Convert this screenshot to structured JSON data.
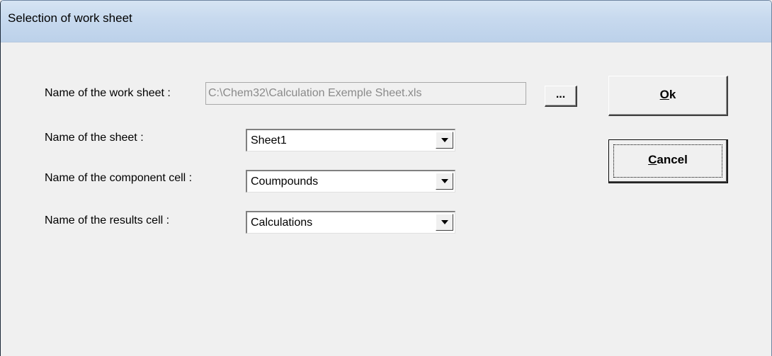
{
  "window": {
    "title": "Selection of work sheet"
  },
  "form": {
    "work_sheet_label": "Name of the work sheet :",
    "work_sheet_path": "C:\\Chem32\\Calculation Exemple Sheet.xls",
    "browse_label": "...",
    "sheet_label": "Name of the sheet :",
    "sheet_value": "Sheet1",
    "component_cell_label": "Name of the component cell :",
    "component_cell_value": "Coumpounds",
    "results_cell_label": "Name of the results cell :",
    "results_cell_value": "Calculations"
  },
  "buttons": {
    "ok_accel": "O",
    "ok_rest": "k",
    "cancel_accel": "C",
    "cancel_rest": "ancel"
  },
  "icons": {
    "combo_arrow": "chevron-down-icon"
  }
}
